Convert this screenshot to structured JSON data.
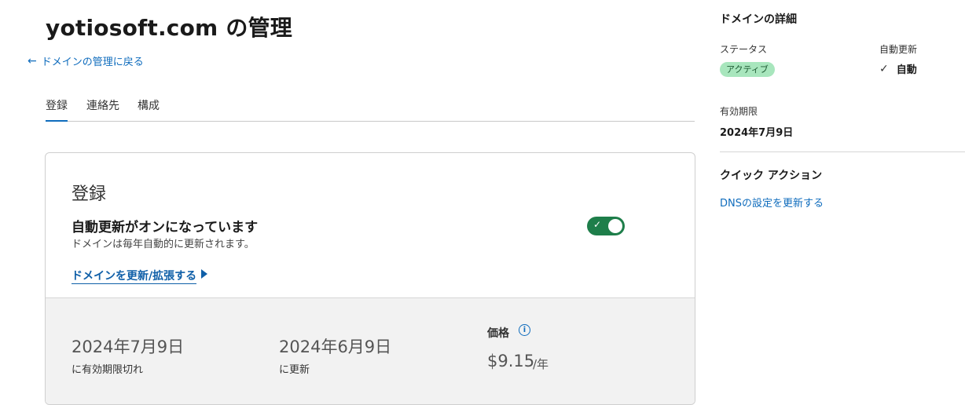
{
  "page": {
    "title": "yotiosoft.com の管理",
    "back_link": "ドメインの管理に戻る"
  },
  "tabs": [
    {
      "label": "登録",
      "active": true
    },
    {
      "label": "連絡先",
      "active": false
    },
    {
      "label": "構成",
      "active": false
    }
  ],
  "registration": {
    "title": "登録",
    "auto_renew_heading": "自動更新がオンになっています",
    "auto_renew_sub": "ドメインは毎年自動的に更新されます。",
    "auto_renew_on": true,
    "extend_link": "ドメインを更新/拡張する",
    "expiry_date": "2024年7月9日",
    "expiry_caption": "に有効期限切れ",
    "renew_date": "2024年6月9日",
    "renew_caption": "に更新",
    "price_label": "価格",
    "price_value": "$9.15",
    "price_unit": "/年"
  },
  "sidebar": {
    "title": "ドメインの詳細",
    "status_label": "ステータス",
    "status_value": "アクティブ",
    "auto_renew_label": "自動更新",
    "auto_renew_value": "自動",
    "expiry_label": "有効期限",
    "expiry_value": "2024年7月9日",
    "quick_actions_title": "クイック アクション",
    "dns_link": "DNSの設定を更新する"
  },
  "icons": {
    "back": "arrow-left-icon",
    "info": "info-icon",
    "check": "checkmark-icon",
    "caret": "caret-right-icon"
  },
  "colors": {
    "accent": "#0f6cbd",
    "toggle_on": "#1e7e4a",
    "badge_bg": "#a8e6bd"
  }
}
